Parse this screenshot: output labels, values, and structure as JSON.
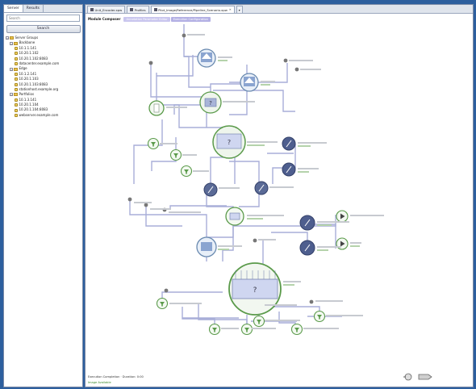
{
  "left_panel": {
    "tabs": [
      "Server",
      "Results"
    ],
    "search_placeholder": "Search",
    "search_button": "Search",
    "tree": [
      {
        "label": "Server Groups",
        "level": 0,
        "type": "folder"
      },
      {
        "label": "Backbone",
        "level": 1,
        "type": "folder"
      },
      {
        "label": "10.1.1.141",
        "level": 2,
        "type": "node"
      },
      {
        "label": "10.20.1.102",
        "level": 2,
        "type": "node"
      },
      {
        "label": "10.20.1.102:8083",
        "level": 2,
        "type": "node"
      },
      {
        "label": "datacenter.example.com",
        "level": 2,
        "type": "node"
      },
      {
        "label": "Edge",
        "level": 1,
        "type": "folder"
      },
      {
        "label": "10.1.2.141",
        "level": 2,
        "type": "node"
      },
      {
        "label": "10.20.1.103",
        "level": 2,
        "type": "node"
      },
      {
        "label": "10.20.1.103:8083",
        "level": 2,
        "type": "node"
      },
      {
        "label": "stationhost.example.org",
        "level": 2,
        "type": "node"
      },
      {
        "label": "Portfolios",
        "level": 1,
        "type": "folder"
      },
      {
        "label": "10.1.3.141",
        "level": 2,
        "type": "node"
      },
      {
        "label": "10.20.1.104",
        "level": 2,
        "type": "node"
      },
      {
        "label": "10.20.1.104:8083",
        "level": 2,
        "type": "node"
      },
      {
        "label": "webserver.example.com",
        "level": 2,
        "type": "node"
      }
    ]
  },
  "tabs": [
    {
      "label": "Unit_Encoder.xpw",
      "active": false
    },
    {
      "label": "Profiles",
      "active": false
    },
    {
      "label": "Pilot_Image/Reference/Pipeline_Scenario.xpw",
      "active": true
    },
    {
      "label": "",
      "active": false
    }
  ],
  "module_header": {
    "label": "Module Composer",
    "chips": [
      "Annotation Parameter Editor",
      "Execution Configuration"
    ]
  },
  "status": {
    "line1": "Execution Completion · Duration: 0:00",
    "line2": "Image Available"
  },
  "colors": {
    "frame": "#2d5f9e",
    "node_green": "#5a9a4a",
    "node_blue": "#4a5a8a",
    "edge": "#a8aed8"
  }
}
